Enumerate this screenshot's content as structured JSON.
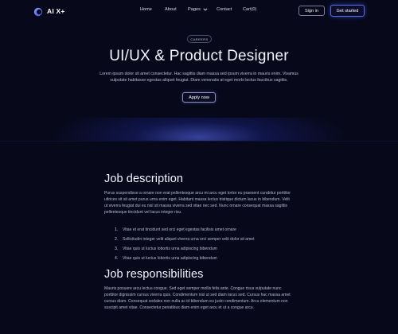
{
  "header": {
    "logo_text": "AI X+",
    "nav": [
      {
        "label": "Home"
      },
      {
        "label": "About"
      },
      {
        "label": "Pages"
      },
      {
        "label": "Contact"
      },
      {
        "label": "Cart(0)"
      }
    ],
    "signin_label": "Sign in",
    "get_started_label": "Get started"
  },
  "hero": {
    "chip_label": "CAREERS",
    "title": "UI/UX & Product Designer",
    "subtitle": "Lorem ipsum dolor sit amet consectetur. Hac sagittis diam massa sed ipsum viverra in mauris enim. Vivamus vulputate habitasse egestas aliquet feugiat. Diam venenatis at eget morbi lectus faucibus sagittis.",
    "apply_label": "Apply now"
  },
  "job_description": {
    "heading": "Job description",
    "paragraph": "Purus suspendisse a ornare non erat pellentesque arcu mi arcu eget tortor eu praesent curabitur porttitor ultrices sit sit amet purus urna enim eget. Habitant massa lectus tristique dictum lacus in bibendum. Velit ut viverra feugiat dui eu nisl sit massa viverra sed vitae nec sed. Nunc ornare consequat massa sagittis pellentesque tincidunt vel lacus integer risu.",
    "items": [
      {
        "num": "1.",
        "text": "Vitae et erat tincidunt sed orci eget egestas facilisis amet ornare"
      },
      {
        "num": "2.",
        "text": "Sollicitudin integer  velit aliquet viverra urna orci semper velit dolor sit amet"
      },
      {
        "num": "3.",
        "text": "Vitae quis ut  luctus lobortis urna adipiscing bibendum"
      },
      {
        "num": "4.",
        "text": "Vitae quis ut  luctus lobortis urna adipiscing bibendum"
      }
    ]
  },
  "job_responsibilities": {
    "heading": "Job responsibilities",
    "paragraph": "Mauris posuere arcu lectus congue. Sed eget semper mollis felis ante. Congue risus vulputate nunc porttitor dignissim cursus viverra quis. Condimentum nisl ut sed diam lacus sed. Cursus hac massa amet cursus diam. Consequat sodales non nulla ac id bibendum eu justo condimentum. Arcu elementum non suscipit amet vitae. Consectetur penatibus diam enim eget arcu et ut a congue arcu."
  },
  "colors": {
    "background": "#07081a",
    "accent": "#5a6de0",
    "heading": "#f4f5ff",
    "body_text": "#b6b9d3"
  }
}
